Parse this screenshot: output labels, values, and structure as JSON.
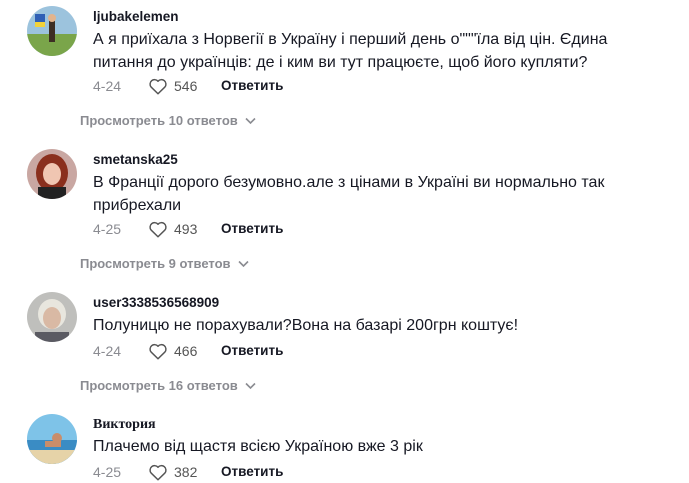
{
  "comments": [
    {
      "username": "ljubakelemen",
      "text": "А я приїхала з Норвегії в Україну і перший день о\"\"\"їла від цін. Єдина питання до українців: де і ким ви тут працюєте, щоб його купляти?",
      "date": "4-24",
      "likes": "546",
      "reply_label": "Ответить",
      "view_replies": "Просмотреть 10 ответов"
    },
    {
      "username": "smetanska25",
      "text": "В Франції дорого безумовно.але з цінами в Україні ви нормально так прибрехали",
      "date": "4-25",
      "likes": "493",
      "reply_label": "Ответить",
      "view_replies": "Просмотреть 9 ответов"
    },
    {
      "username": "user3338536568909",
      "text": "Полуницю не порахували?Вона на базарі 200грн коштує!",
      "date": "4-24",
      "likes": "466",
      "reply_label": "Ответить",
      "view_replies": "Просмотреть 16 ответов"
    },
    {
      "username": "Виктория",
      "text": "Плачемо від щастя всією Україною вже 3 рік",
      "date": "4-25",
      "likes": "382",
      "reply_label": "Ответить"
    }
  ],
  "colors": {
    "text_primary": "#161823",
    "text_secondary": "#8a8b91"
  },
  "icons": {
    "like": "heart-outline-icon",
    "expand": "chevron-down-icon"
  }
}
